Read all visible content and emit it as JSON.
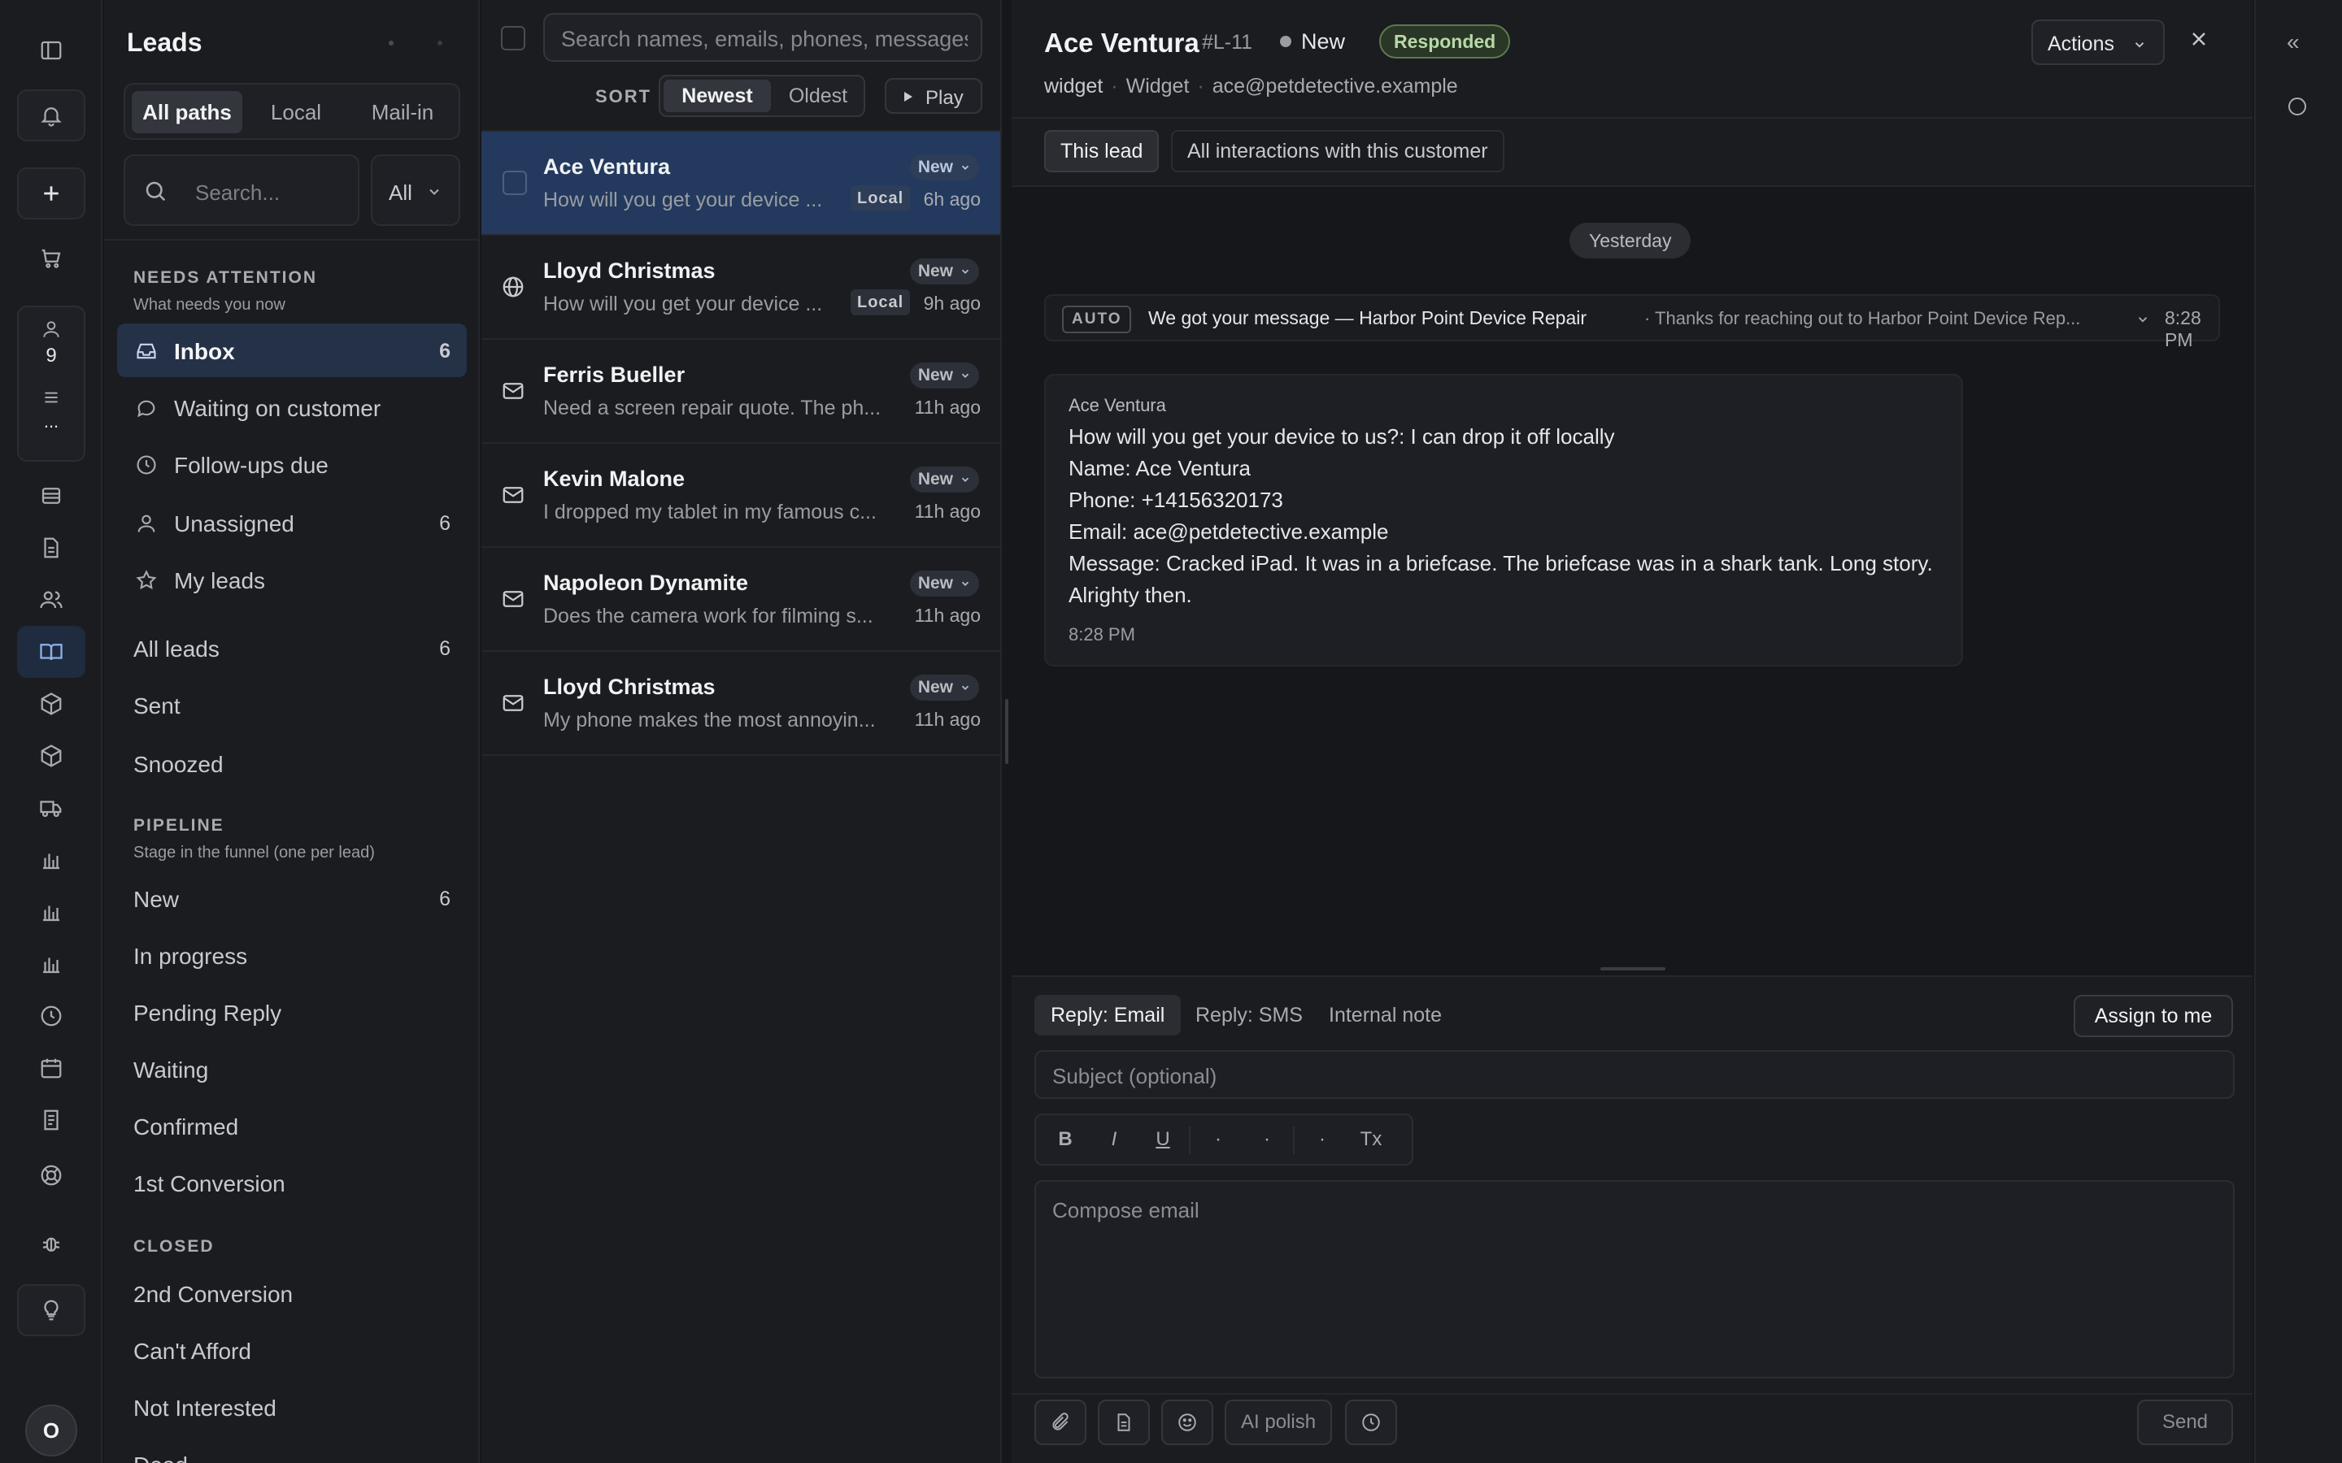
{
  "rail": {
    "user_count": "9",
    "more": "...",
    "avatar_initial": "O"
  },
  "sidebar": {
    "title": "Leads",
    "paths": [
      "All paths",
      "Local",
      "Mail-in"
    ],
    "search_placeholder": "Search...",
    "filter": "All",
    "needs_attention": {
      "heading": "NEEDS ATTENTION",
      "sub": "What needs you now"
    },
    "attention_items": [
      {
        "label": "Inbox",
        "count": "6",
        "icon": "inbox-icon"
      },
      {
        "label": "Waiting on customer",
        "count": "",
        "icon": "chat-bubble-icon"
      },
      {
        "label": "Follow-ups due",
        "count": "",
        "icon": "clock-icon"
      },
      {
        "label": "Unassigned",
        "count": "6",
        "icon": "user-icon"
      },
      {
        "label": "My leads",
        "count": "",
        "icon": "star-icon"
      }
    ],
    "general_items": [
      {
        "label": "All leads",
        "count": "6"
      },
      {
        "label": "Sent",
        "count": ""
      },
      {
        "label": "Snoozed",
        "count": ""
      }
    ],
    "pipeline": {
      "heading": "PIPELINE",
      "sub": "Stage in the funnel (one per lead)"
    },
    "pipeline_items": [
      {
        "label": "New",
        "count": "6"
      },
      {
        "label": "In progress",
        "count": ""
      },
      {
        "label": "Pending Reply",
        "count": ""
      },
      {
        "label": "Waiting",
        "count": ""
      },
      {
        "label": "Confirmed",
        "count": ""
      },
      {
        "label": "1st Conversion",
        "count": ""
      }
    ],
    "closed": {
      "heading": "CLOSED"
    },
    "closed_items": [
      {
        "label": "2nd Conversion"
      },
      {
        "label": "Can't Afford"
      },
      {
        "label": "Not Interested"
      },
      {
        "label": "Dead"
      }
    ]
  },
  "list": {
    "search_placeholder": "Search names, emails, phones, messages",
    "sort_label": "SORT",
    "sort_options": [
      "Newest",
      "Oldest"
    ],
    "play_label": "Play",
    "rows": [
      {
        "name": "Ace Ventura",
        "preview": "How will you get your device ...",
        "status": "New",
        "badge": "Local",
        "time": "6h ago",
        "icon": "checkbox"
      },
      {
        "name": "Lloyd Christmas",
        "preview": "How will you get your device ...",
        "status": "New",
        "badge": "Local",
        "time": "9h ago",
        "icon": "globe-icon"
      },
      {
        "name": "Ferris Bueller",
        "preview": "Need a screen repair quote. The ph...",
        "status": "New",
        "badge": "",
        "time": "11h ago",
        "icon": "mail-icon"
      },
      {
        "name": "Kevin Malone",
        "preview": "I dropped my tablet in my famous c...",
        "status": "New",
        "badge": "",
        "time": "11h ago",
        "icon": "mail-icon"
      },
      {
        "name": "Napoleon Dynamite",
        "preview": "Does the camera work for filming s...",
        "status": "New",
        "badge": "",
        "time": "11h ago",
        "icon": "mail-icon"
      },
      {
        "name": "Lloyd Christmas",
        "preview": "My phone makes the most annoyin...",
        "status": "New",
        "badge": "",
        "time": "11h ago",
        "icon": "mail-icon"
      }
    ]
  },
  "detail": {
    "name": "Ace Ventura",
    "lead_id": "#L-11",
    "status": "New",
    "response_badge": "Responded",
    "source_key": "widget",
    "source_label": "Widget",
    "email": "ace@petdetective.example",
    "actions_label": "Actions",
    "scope_tabs": [
      "This lead",
      "All interactions with this customer"
    ],
    "date_chip": "Yesterday",
    "auto": {
      "tag": "AUTO",
      "title": "We got your message — Harbor Point Device Repair",
      "snippet": "· Thanks for reaching out to Harbor Point Device Rep...",
      "time": "8:28 PM"
    },
    "message": {
      "from": "Ace Ventura",
      "lines": [
        "How will you get your device to us?: I can drop it off locally",
        "Name: Ace Ventura",
        "Phone: +14156320173",
        "Email: ace@petdetective.example",
        "Message: Cracked iPad. It was in a briefcase. The briefcase was in a shark tank. Long story. Alrighty then."
      ],
      "time": "8:28 PM"
    }
  },
  "composer": {
    "tabs": [
      "Reply: Email",
      "Reply: SMS",
      "Internal note"
    ],
    "assign_label": "Assign to me",
    "subject_placeholder": "Subject (optional)",
    "toolbar": [
      "B",
      "I",
      "U",
      "·",
      "·",
      "·",
      "Tx"
    ],
    "body_placeholder": "Compose email",
    "ai_polish_label": "AI polish",
    "send_label": "Send"
  },
  "right_panel": {
    "collapse_glyph": "«"
  }
}
